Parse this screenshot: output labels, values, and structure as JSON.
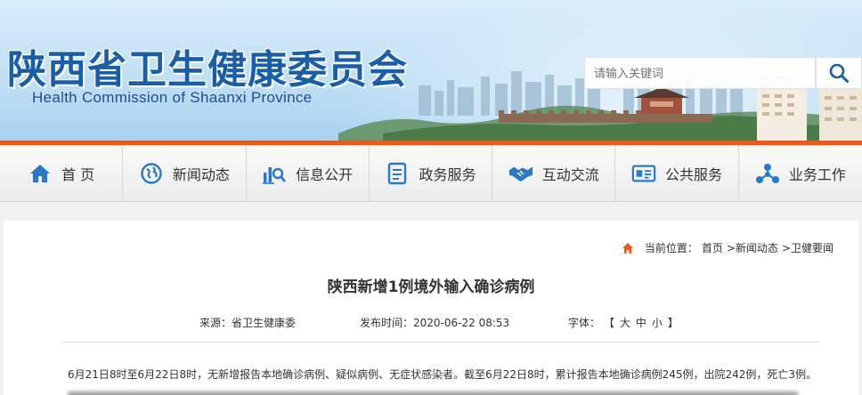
{
  "header": {
    "title": "陕西省卫生健康委员会",
    "subtitle": "Health Commission of Shaanxi Province",
    "search_placeholder": "请输入关键词"
  },
  "nav": {
    "items": [
      {
        "label": "首 页",
        "icon": "home-icon"
      },
      {
        "label": "新闻动态",
        "icon": "globe-icon"
      },
      {
        "label": "信息公开",
        "icon": "chart-search-icon"
      },
      {
        "label": "政务服务",
        "icon": "document-icon"
      },
      {
        "label": "互动交流",
        "icon": "handshake-icon"
      },
      {
        "label": "公共服务",
        "icon": "id-card-icon"
      },
      {
        "label": "业务工作",
        "icon": "network-icon"
      }
    ]
  },
  "breadcrumb": {
    "prefix": "当前位置：",
    "items": [
      "首页",
      ">新闻动态",
      ">卫健要闻"
    ]
  },
  "article": {
    "title": "陕西新增1例境外输入确诊病例",
    "source_label": "来源：省卫生健康委",
    "time_label": "发布时间：",
    "time_value": "2020-06-22 08:53",
    "font_label": "字体：",
    "font_open": "【",
    "font_large": "大",
    "font_medium": "中",
    "font_small": "小",
    "font_close": "】",
    "paragraph_1": "6月21日8时至6月22日8时，无新增报告本地确诊病例、疑似病例、无症状感染者。截至6月22日8时，累计报告本地确诊病例245例，出院242例，死亡3例。"
  },
  "colors": {
    "brand_blue": "#1c5ea6",
    "accent_orange": "#e85a23",
    "nav_icon_blue": "#2a78c6"
  }
}
